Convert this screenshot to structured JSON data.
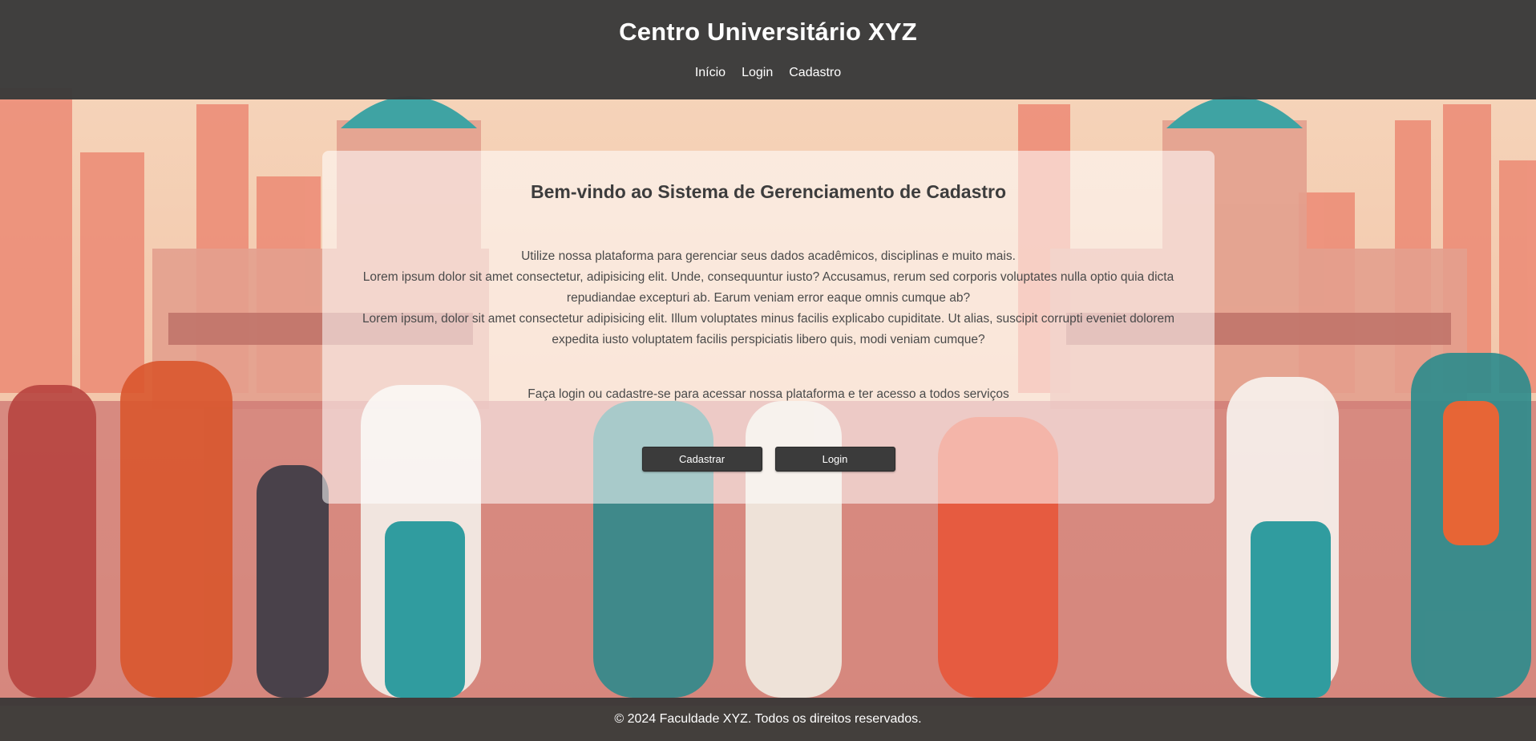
{
  "header": {
    "title": "Centro Universitário XYZ",
    "nav": [
      "Início",
      "Login",
      "Cadastro"
    ]
  },
  "main": {
    "heading": "Bem-vindo ao Sistema de Gerenciamento de Cadastro",
    "intro_lines": [
      "Utilize nossa plataforma para gerenciar seus dados acadêmicos, disciplinas e muito mais.",
      "Lorem ipsum dolor sit amet consectetur, adipisicing elit. Unde, consequuntur iusto? Accusamus, rerum sed corporis voluptates nulla optio quia dicta repudiandae excepturi ab. Earum veniam error eaque omnis cumque ab?",
      "Lorem ipsum, dolor sit amet consectetur adipisicing elit. Illum voluptates minus facilis explicabo cupiditate. Ut alias, suscipit corrupti eveniet dolorem expedita iusto voluptatem facilis perspiciatis libero quis, modi veniam cumque?"
    ],
    "cta_text": "Faça login ou cadastre-se para acessar nossa plataforma e ter acesso a todos serviços",
    "buttons": {
      "register": "Cadastrar",
      "login": "Login"
    }
  },
  "footer": {
    "text": "© 2024 Faculdade XYZ. Todos os direitos reservados."
  },
  "colors": {
    "header_bg": "#3a3a3a",
    "button_bg": "#3b3b3b",
    "card_bg": "#ffffff"
  }
}
